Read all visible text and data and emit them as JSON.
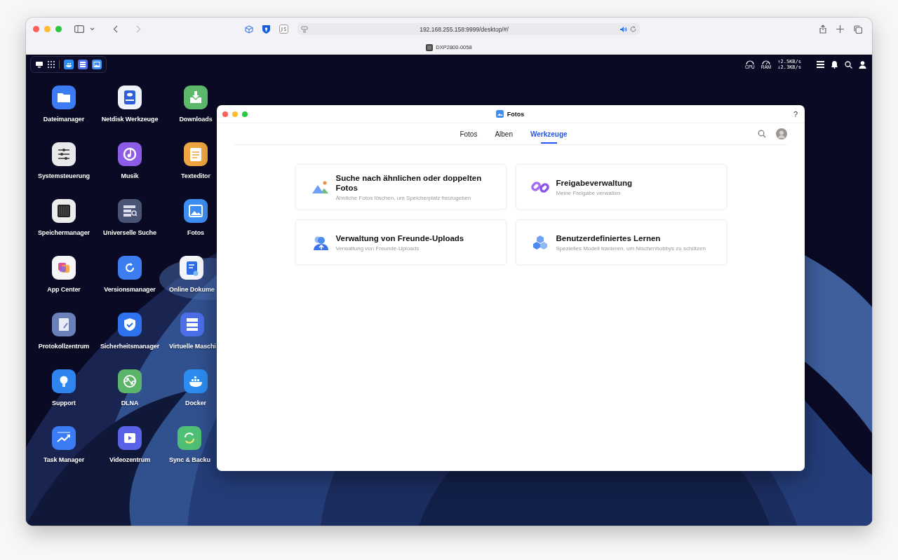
{
  "browser": {
    "url": "192.168.255.158:9999/desktop/#/",
    "tab_title": "DXP2800-0058"
  },
  "desktop": {
    "status": {
      "cpu_label": "CPU",
      "ram_label": "RAM",
      "upload": "↑2.5KB/s",
      "download": "↓2.3KB/s"
    },
    "apps": [
      {
        "label": "Dateimanager"
      },
      {
        "label": "Netdisk Werkzeuge"
      },
      {
        "label": "Downloads"
      },
      {
        "label": "Systemsteuerung"
      },
      {
        "label": "Musik"
      },
      {
        "label": "Texteditor"
      },
      {
        "label": "Speichermanager"
      },
      {
        "label": "Universelle Suche"
      },
      {
        "label": "Fotos"
      },
      {
        "label": "App Center"
      },
      {
        "label": "Versionsmanager"
      },
      {
        "label": "Online Dokume",
        "cut": true
      },
      {
        "label": "Protokollzentrum"
      },
      {
        "label": "Sicherheitsmanager"
      },
      {
        "label": "Virtuelle Maschi",
        "cut": true
      },
      {
        "label": "Support"
      },
      {
        "label": "DLNA"
      },
      {
        "label": "Docker"
      },
      {
        "label": "Task Manager"
      },
      {
        "label": "Videozentrum"
      },
      {
        "label": "Sync & Backu",
        "cut": true
      }
    ]
  },
  "window": {
    "title": "Fotos",
    "help": "?",
    "tabs": [
      {
        "label": "Fotos",
        "selected": false
      },
      {
        "label": "Alben",
        "selected": false
      },
      {
        "label": "Werkzeuge",
        "selected": true
      }
    ],
    "cards": [
      {
        "title": "Suche nach ähnlichen oder doppelten Fotos",
        "subtitle": "Ähnliche Fotos löschen, um Speicherplatz freizugeben"
      },
      {
        "title": "Freigabeverwaltung",
        "subtitle": "Meine Freigabe verwalten"
      },
      {
        "title": "Verwaltung von Freunde-Uploads",
        "subtitle": "Verwaltung von Freunde-Uploads"
      },
      {
        "title": "Benutzerdefiniertes Lernen",
        "subtitle": "Spezielles Modell tranieren, um Nischenhobbys zu schützen"
      }
    ]
  }
}
